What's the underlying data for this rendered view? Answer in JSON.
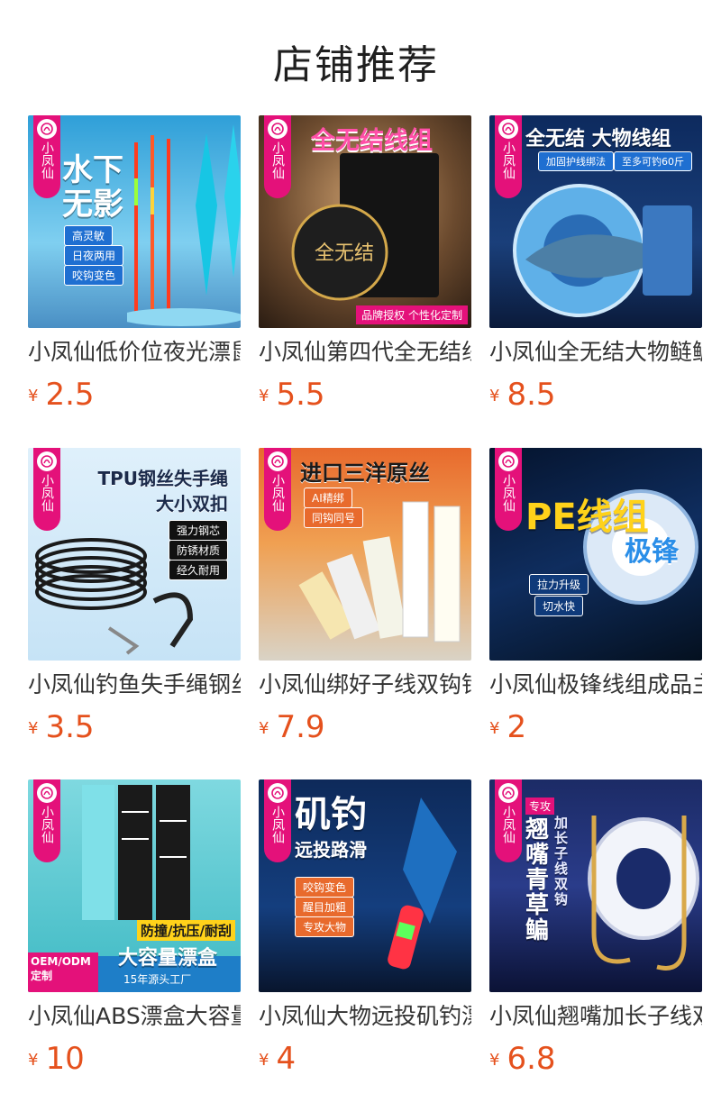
{
  "page": {
    "title": "店铺推荐"
  },
  "brand": {
    "name": "小凤仙",
    "color": "#e4117a"
  },
  "accent": {
    "price_color": "#e5511d"
  },
  "products": [
    {
      "title": "小凤仙低价位夜光漂鼠",
      "currency": "¥",
      "price": "2.5",
      "ad": {
        "headline": "水下无影",
        "tags": [
          "高灵敏",
          "日夜两用",
          "咬钩变色"
        ]
      }
    },
    {
      "title": "小凤仙第四代全无结线组",
      "currency": "¥",
      "price": "5.5",
      "ad": {
        "headline": "全无结线组",
        "badge": "品牌授权 个性化定制"
      }
    },
    {
      "title": "小凤仙全无结大物鲢鳙",
      "currency": "¥",
      "price": "8.5",
      "ad": {
        "headline": "全无结 大物线组",
        "tags": [
          "加固护线绑法",
          "至多可钓60斤"
        ]
      }
    },
    {
      "title": "小凤仙钓鱼失手绳钢丝",
      "currency": "¥",
      "price": "3.5",
      "ad": {
        "headline": "TPU钢丝失手绳",
        "subhead": "大小双扣",
        "tags": [
          "强力钢芯",
          "防锈材质",
          "经久耐用"
        ]
      }
    },
    {
      "title": "小凤仙绑好子线双钩钩",
      "currency": "¥",
      "price": "7.9",
      "ad": {
        "headline": "进口三洋原丝",
        "tags": [
          "AI精绑",
          "同钩同号"
        ]
      }
    },
    {
      "title": "小凤仙极锋线组成品主",
      "currency": "¥",
      "price": "2",
      "ad": {
        "headline": "PE线组",
        "subhead": "极锋",
        "tags": [
          "拉力升级",
          "切水快"
        ]
      }
    },
    {
      "title": "小凤仙ABS漂盒大容量",
      "currency": "¥",
      "price": "10",
      "ad": {
        "headline": "大容量漂盒",
        "subhead": "防撞/抗压/耐刮",
        "corner": "OEM/ODM定制",
        "footer": "15年源头工厂"
      }
    },
    {
      "title": "小凤仙大物远投矶钓漂",
      "currency": "¥",
      "price": "4",
      "ad": {
        "headline": "矶钓",
        "subhead": "远投路滑",
        "tags": [
          "咬钩变色",
          "醒目加粗",
          "专攻大物"
        ]
      }
    },
    {
      "title": "小凤仙翘嘴加长子线双",
      "currency": "¥",
      "price": "6.8",
      "ad": {
        "headline": "翘嘴青草鳊",
        "subhead": "加长子线双钩",
        "tag": "专攻"
      }
    }
  ]
}
